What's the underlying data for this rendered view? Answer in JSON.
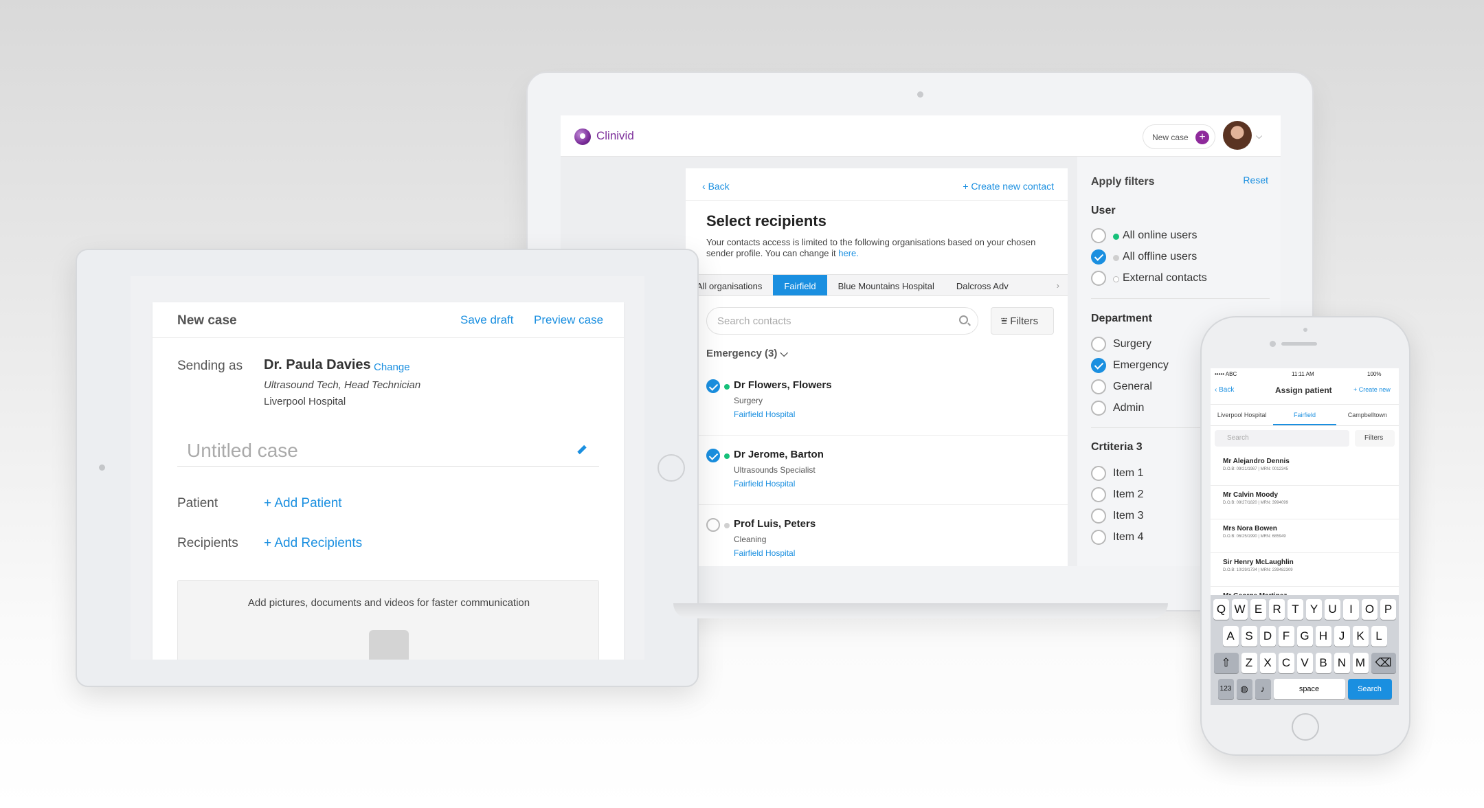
{
  "laptop": {
    "brand": "Clinivid",
    "new_case_label": "New case",
    "back": "Back",
    "create_contact": "+ Create new contact",
    "title": "Select recipients",
    "description": "Your contacts access is limited to the following organisations based on your chosen sender profile. You can change it",
    "description_link": "here.",
    "tabs": [
      "All organisations",
      "Fairfield",
      "Blue Mountains Hospital",
      "Dalcross Adv"
    ],
    "search_placeholder": "Search contacts",
    "filters_label": "Filters",
    "group_label": "Emergency (3)",
    "contacts": [
      {
        "name": "Dr Flowers, Flowers",
        "role": "Surgery",
        "org": "Fairfield Hospital",
        "selected": true,
        "online": true
      },
      {
        "name": "Dr Jerome, Barton",
        "role": "Ultrasounds Specialist",
        "org": "Fairfield Hospital",
        "selected": true,
        "online": true
      },
      {
        "name": "Prof Luis, Peters",
        "role": "Cleaning",
        "org": "Fairfield Hospital",
        "selected": false,
        "online": false
      }
    ],
    "filters": {
      "title": "Apply filters",
      "reset": "Reset",
      "user_heading": "User",
      "user_items": [
        "All online users",
        "All offline users",
        "External contacts"
      ],
      "dept_heading": "Department",
      "dept_items": [
        "Surgery",
        "Emergency",
        "General",
        "Admin"
      ],
      "crit_heading": "Crtiteria 3",
      "crit_items": [
        "Item 1",
        "Item 2",
        "Item 3",
        "Item 4"
      ]
    }
  },
  "tablet": {
    "title": "New case",
    "save_draft": "Save draft",
    "preview_case": "Preview case",
    "sending_as_label": "Sending as",
    "sender_name": "Dr. Paula Davies",
    "change": "Change",
    "sender_role": "Ultrasound Tech, Head Technician",
    "sender_org": "Liverpool Hospital",
    "case_placeholder": "Untitled case",
    "patient_label": "Patient",
    "add_patient": "+ Add Patient",
    "recipients_label": "Recipients",
    "add_recipients": "+ Add Recipients",
    "attach_text": "Add pictures, documents and videos for faster communication"
  },
  "phone": {
    "carrier": "••••• ABC",
    "time": "11:11 AM",
    "battery": "100%",
    "back": "Back",
    "title": "Assign patient",
    "create_new": "+ Create new",
    "tabs": [
      "Liverpool Hospital",
      "Fairfield",
      "Campbelltown"
    ],
    "search_placeholder": "Search",
    "filters": "Filters",
    "patients": [
      {
        "name": "Mr Alejandro Dennis",
        "meta": "D.O.B: 09/21/1987  |  MRN: 0012345"
      },
      {
        "name": "Mr Calvin Moody",
        "meta": "D.O.B: 09/27/1820  |  MRN: 3994099"
      },
      {
        "name": "Mrs Nora Bowen",
        "meta": "D.O.B: 06/25/1990  |  MRN: 685949"
      },
      {
        "name": "Sir Henry McLaughlin",
        "meta": "D.O.B: 10/29/1734  |  MRN: 239482309"
      },
      {
        "name": "Mr George Martinez",
        "meta": ""
      }
    ],
    "keyboard": {
      "row1": [
        "Q",
        "W",
        "E",
        "R",
        "T",
        "Y",
        "U",
        "I",
        "O",
        "P"
      ],
      "row2": [
        "A",
        "S",
        "D",
        "F",
        "G",
        "H",
        "J",
        "K",
        "L"
      ],
      "row3": [
        "Z",
        "X",
        "C",
        "V",
        "B",
        "N",
        "M"
      ],
      "num": "123",
      "space": "space",
      "search": "Search"
    }
  },
  "colors": {
    "accent": "#1a8fe0",
    "brand": "#7b2d9a",
    "online": "#16c07a"
  }
}
